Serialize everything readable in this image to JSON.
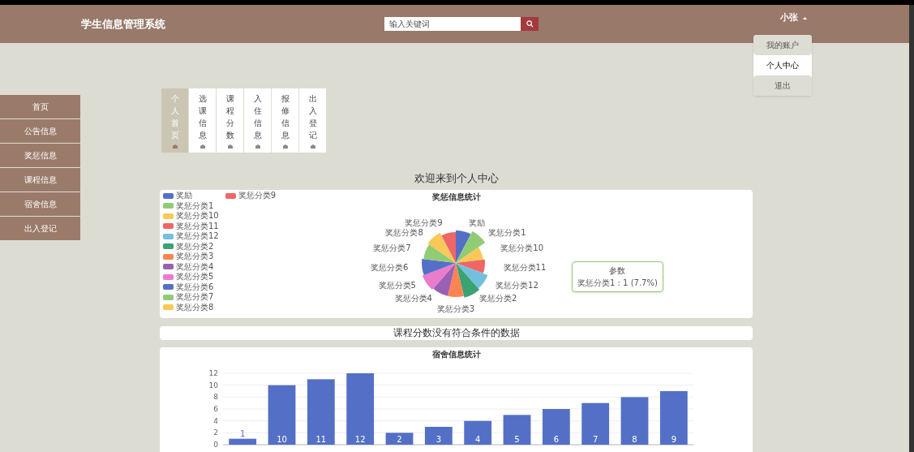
{
  "header": {
    "title": "学生信息管理系统",
    "search": {
      "placeholder": "输入关键词"
    },
    "user": "小张",
    "user_menu": [
      {
        "label": "我的账户",
        "selected": false
      },
      {
        "label": "个人中心",
        "selected": true
      },
      {
        "label": "退出",
        "selected": false
      }
    ]
  },
  "sidebar": {
    "items": [
      {
        "label": "首页"
      },
      {
        "label": "公告信息"
      },
      {
        "label": "奖惩信息"
      },
      {
        "label": "课程信息"
      },
      {
        "label": "宿舍信息"
      },
      {
        "label": "出入登记"
      }
    ]
  },
  "tabs": [
    {
      "label": "个人首页",
      "selected": true
    },
    {
      "label": "选课信息",
      "selected": false
    },
    {
      "label": "课程分数",
      "selected": false
    },
    {
      "label": "入住信息",
      "selected": false
    },
    {
      "label": "报修信息",
      "selected": false
    },
    {
      "label": "出入登记",
      "selected": false
    }
  ],
  "welcome": "欢迎来到个人中心",
  "award_chart": {
    "title": "奖惩信息统计",
    "labels_left": [
      "奖惩分类9",
      "奖惩分类8",
      "奖惩分类7",
      "奖惩分类6",
      "奖惩分类5",
      "奖惩分类4"
    ],
    "labels_right": [
      "奖励",
      "奖惩分类1",
      "奖惩分类10",
      "奖惩分类11",
      "奖惩分类12",
      "奖惩分类2",
      "奖惩分类3"
    ],
    "legend": [
      {
        "label": "奖励",
        "color": "#5470c6"
      },
      {
        "label": "奖惩分类1",
        "color": "#91cc75"
      },
      {
        "label": "奖惩分类10",
        "color": "#fac858"
      },
      {
        "label": "奖惩分类11",
        "color": "#ee6666"
      },
      {
        "label": "奖惩分类12",
        "color": "#73c0de"
      },
      {
        "label": "奖惩分类2",
        "color": "#3ba272"
      },
      {
        "label": "奖惩分类3",
        "color": "#fc8452"
      },
      {
        "label": "奖惩分类4",
        "color": "#9a60b4"
      },
      {
        "label": "奖惩分类5",
        "color": "#ea7ccc"
      },
      {
        "label": "奖惩分类6",
        "color": "#5470c6"
      },
      {
        "label": "奖惩分类7",
        "color": "#91cc75"
      },
      {
        "label": "奖惩分类8",
        "color": "#fac858"
      },
      {
        "label": "奖惩分类9",
        "color": "#ee6666"
      }
    ],
    "tooltip": {
      "title": "参数",
      "text": "奖惩分类1 : 1 (7.7%)"
    }
  },
  "score_message": "课程分数没有符合条件的数据",
  "dorm_chart": {
    "chart_data": {
      "type": "bar",
      "title": "宿舍信息统计",
      "values": [
        1,
        10,
        11,
        12,
        2,
        3,
        4,
        5,
        6,
        7,
        8,
        9
      ],
      "ylim": [
        0,
        12
      ],
      "yticks": [
        0,
        2,
        4,
        6,
        8,
        10,
        12
      ],
      "grid": true,
      "data_labels": true
    }
  }
}
